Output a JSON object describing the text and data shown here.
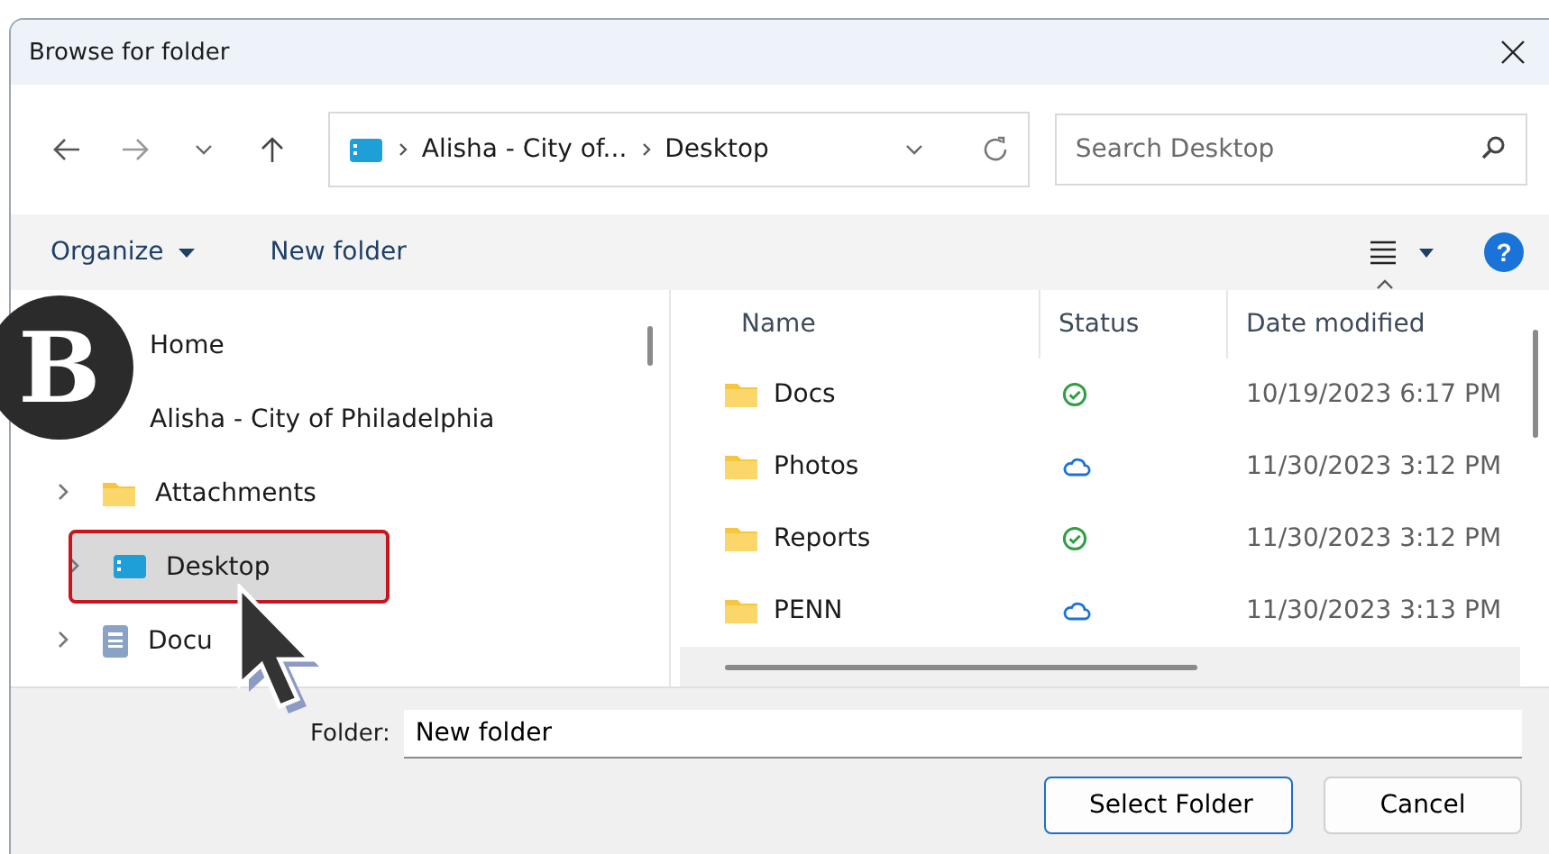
{
  "window": {
    "title": "Browse for folder"
  },
  "address": {
    "crumbs": [
      "Alisha - City of...",
      "Desktop"
    ]
  },
  "search": {
    "placeholder": "Search Desktop"
  },
  "toolbar": {
    "organize": "Organize",
    "new_folder": "New folder",
    "help": "?"
  },
  "tree": [
    {
      "label": "Home",
      "selected": false
    },
    {
      "label": "Alisha - City of Philadelphia",
      "selected": false,
      "children": [
        {
          "label": "Attachments",
          "kind": "folder",
          "selected": false
        },
        {
          "label": "Desktop",
          "kind": "desktop",
          "selected": true
        },
        {
          "label": "Docu",
          "kind": "documents",
          "selected": false
        }
      ]
    }
  ],
  "table": {
    "columns": [
      "Name",
      "Status",
      "Date modified"
    ],
    "rows": [
      {
        "name": "Docs",
        "kind": "synced",
        "date": "10/19/2023 6:17 PM"
      },
      {
        "name": "Photos",
        "kind": "cloud",
        "date": "11/30/2023 3:12 PM"
      },
      {
        "name": "Reports",
        "kind": "synced",
        "date": "11/30/2023 3:12 PM"
      },
      {
        "name": "PENN",
        "kind": "cloud",
        "date": "11/30/2023 3:13 PM"
      }
    ]
  },
  "folder": {
    "label": "Folder:",
    "value": "New folder"
  },
  "buttons": [
    {
      "label": "Select Folder",
      "default": true
    },
    {
      "label": "Cancel",
      "default": false
    }
  ],
  "annotation": {
    "badge": "B"
  }
}
